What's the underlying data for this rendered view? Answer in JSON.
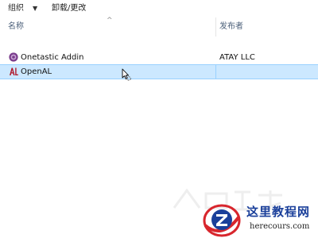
{
  "toolbar": {
    "organize_label": "组织",
    "organize_arrow": "▼",
    "uninstall_label": "卸载/更改"
  },
  "columns": {
    "name_label": "名称",
    "sort_indicator": "^",
    "publisher_label": "发布者"
  },
  "rows": [
    {
      "name": "Onetastic Addin",
      "publisher": "ATAY LLC",
      "icon": "onetastic-icon",
      "selected": false
    },
    {
      "name": "OpenAL",
      "publisher": "",
      "icon": "openal-icon",
      "selected": true
    }
  ],
  "cursor": "arrow-busy-cursor",
  "watermark": {
    "site_title": "这里教程网",
    "site_url": "herecours.com"
  },
  "colors": {
    "selected_row": "#cce8ff",
    "selected_border": "#99d1ff",
    "header_text": "#4c607a",
    "logo_blue": "#1a3f9a",
    "logo_red": "#d8262d"
  }
}
